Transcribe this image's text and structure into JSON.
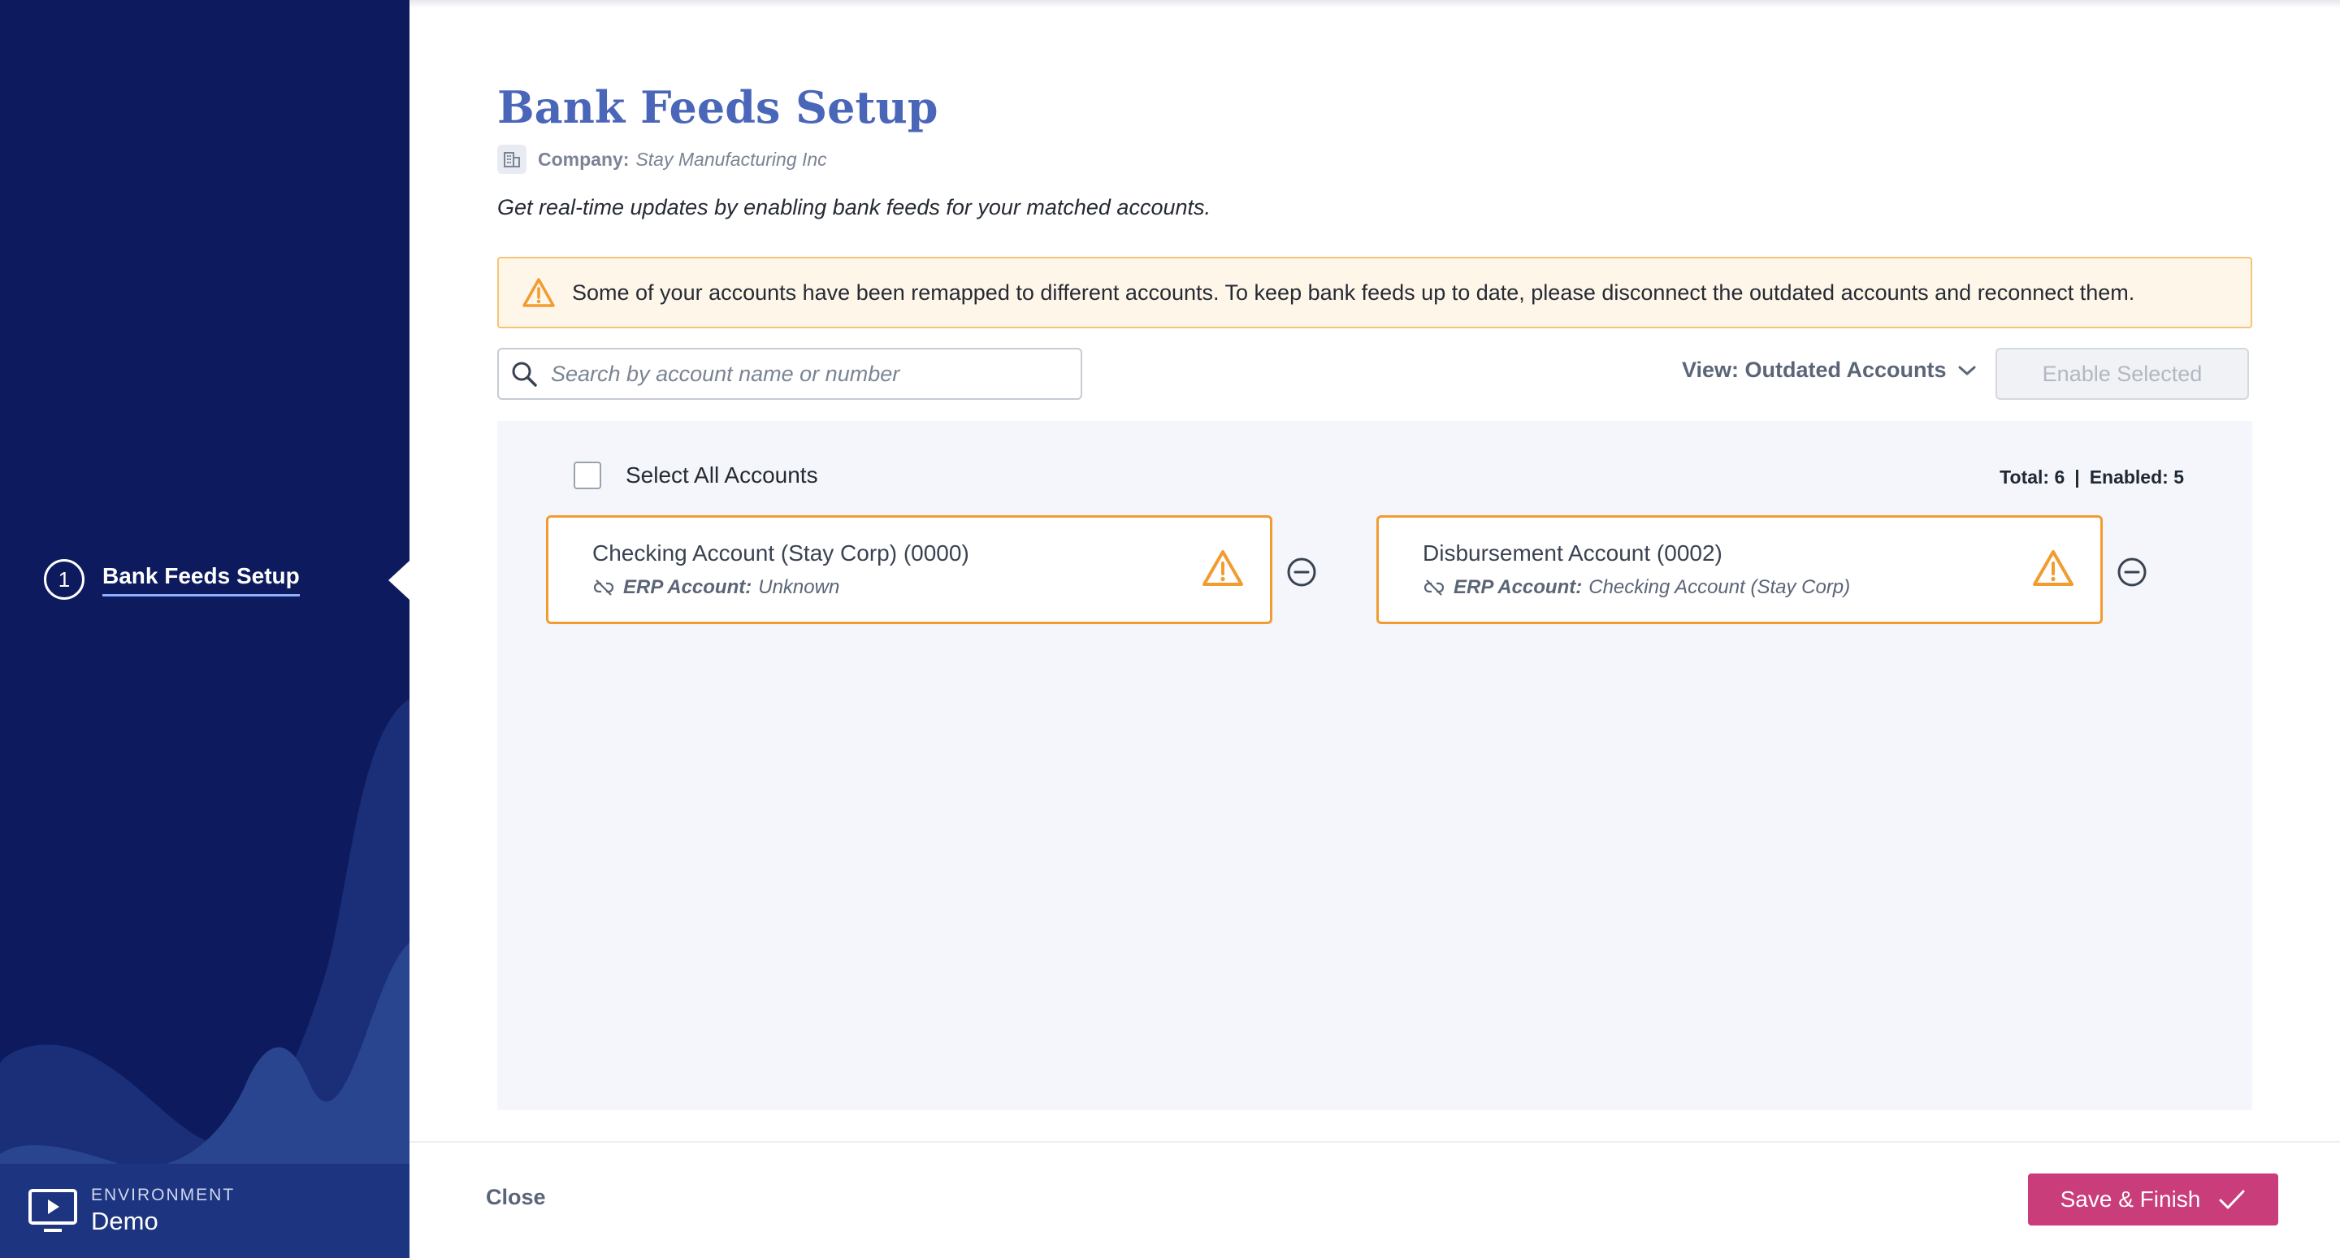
{
  "sidebar": {
    "step_number": "1",
    "step_label": "Bank Feeds Setup",
    "environment_label": "ENVIRONMENT",
    "environment_value": "Demo"
  },
  "header": {
    "title": "Bank Feeds Setup",
    "company_label": "Company:",
    "company_name": "Stay Manufacturing Inc",
    "subtitle": "Get real-time updates by enabling bank feeds for your matched accounts."
  },
  "alert": {
    "text": "Some of your accounts have been remapped to different accounts. To keep bank feeds up to date, please disconnect the outdated accounts and reconnect them."
  },
  "toolbar": {
    "search_placeholder": "Search by account name or number",
    "view_label": "View: Outdated Accounts",
    "enable_selected_label": "Enable Selected"
  },
  "panel": {
    "select_all_label": "Select All Accounts",
    "total_text": "Total: 6",
    "enabled_text": "Enabled: 5",
    "separator": "|"
  },
  "accounts": [
    {
      "name": "Checking Account (Stay Corp) (0000)",
      "erp_label": "ERP Account:",
      "erp_value": "Unknown"
    },
    {
      "name": "Disbursement Account (0002)",
      "erp_label": "ERP Account:",
      "erp_value": "Checking Account (Stay Corp)"
    }
  ],
  "footer": {
    "close_label": "Close",
    "save_label": "Save & Finish"
  },
  "colors": {
    "sidebar_bg": "#0d1b5e",
    "title": "#4a66b8",
    "warning": "#f29b2f",
    "primary_button": "#c93d7a"
  },
  "icons": [
    "building-icon",
    "warning-icon",
    "search-icon",
    "chevron-down-icon",
    "unlink-icon",
    "minus-circle-icon",
    "checkmark-icon",
    "monitor-play-icon"
  ]
}
